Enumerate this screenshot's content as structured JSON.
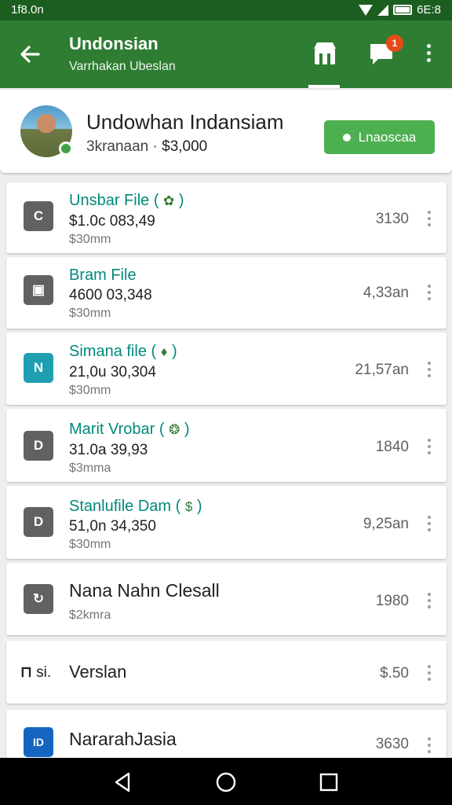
{
  "status_bar": {
    "time": "1f8.0n",
    "right_text": "6E:8"
  },
  "app_bar": {
    "title": "Undonsian",
    "subtitle": "Varrhakan Ubeslan",
    "badge_count": "1"
  },
  "profile": {
    "name": "Undowhan Indansiam",
    "meta_prefix": "3kranaan ·",
    "meta_amount": "$3,000",
    "action_label": "Lnaoscaa"
  },
  "files": [
    {
      "title": "Unsbar File (",
      "badge": "✿",
      "line": "$1.0c 083,49",
      "sub": "$30mm",
      "right": "3130",
      "icon": "C",
      "icon_color": "#616161"
    },
    {
      "title": "Bram File",
      "badge": "",
      "line": "4600 03,348",
      "sub": "$30mm",
      "right": "4,33an",
      "icon": "▣",
      "icon_color": "#616161"
    },
    {
      "title": "Simana file (",
      "badge": "♦",
      "line": "21,0u 30,304",
      "sub": "$30mm",
      "right": "21,57an",
      "icon": "N",
      "icon_color": "#1e9fb1"
    },
    {
      "title": "Marit Vrobar (",
      "badge": "❂",
      "line": "31.0a 39,93",
      "sub": "$3mma",
      "right": "1840",
      "icon": "D",
      "icon_color": "#616161"
    },
    {
      "title": "Stanlufile Dam (",
      "badge": "$",
      "line": "51,0n 34,350",
      "sub": "$30mm",
      "right": "9,25an",
      "icon": "D",
      "icon_color": "#616161"
    },
    {
      "title": "Nana Nahn Clesall",
      "badge": "",
      "line": "",
      "sub": "$2kmra",
      "right": "1980",
      "icon": "↻",
      "icon_color": "#616161"
    },
    {
      "title": "Verslan",
      "prefix": "si.",
      "badge": "",
      "line": "",
      "sub": "",
      "right": "$.50",
      "icon": "",
      "icon_color": "#616161"
    },
    {
      "title": "NararahJasia",
      "badge": "",
      "line": "",
      "sub": "",
      "right": "3630",
      "icon": "ID",
      "icon_color": "#1565c0"
    }
  ],
  "colors": {
    "primary": "#2e7d32",
    "status": "#1b5e20",
    "accent": "#4caf50",
    "link": "#00897b",
    "badge": "#e64a19"
  },
  "icons": [
    "back-arrow-icon",
    "store-icon",
    "chat-icon",
    "more-vert-icon",
    "wifi-icon",
    "signal-icon",
    "battery-icon",
    "nav-back-icon",
    "nav-home-icon",
    "nav-recents-icon"
  ]
}
